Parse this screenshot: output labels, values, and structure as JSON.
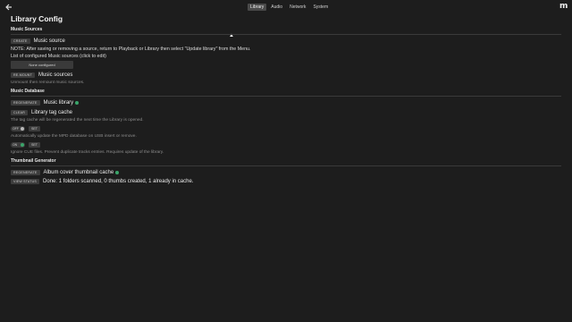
{
  "topbar": {
    "back_icon": "arrow-left-icon",
    "tabs": [
      {
        "label": "Library",
        "active": true
      },
      {
        "label": "Audio",
        "active": false
      },
      {
        "label": "Network",
        "active": false
      },
      {
        "label": "System",
        "active": false
      }
    ],
    "logo_icon": "moode-logo"
  },
  "page": {
    "title": "Library Config"
  },
  "music_sources": {
    "heading": "Music Sources",
    "create_button": "CREATE",
    "create_label": "Music source",
    "note": "NOTE: After saving or removing a source, return to Playback or Library then select \"Update library\" from the Menu.",
    "list_label": "List of configured Music sources (click to edit)",
    "none_configured": "None configured",
    "remount_button": "RE-MOUNT",
    "remount_label": "Music sources",
    "remount_help": "Unmount then remount music sources."
  },
  "music_database": {
    "heading": "Music Database",
    "regenerate_button": "REGENERATE",
    "regenerate_label": "Music library",
    "clear_button": "CLEAR",
    "clear_label": "Library tag cache",
    "clear_help": "The tag cache will be regenerated the next time the Library is opened.",
    "auto_update": {
      "toggle_text": "OFF",
      "set_button": "SET",
      "help": "Automatically update the MPD database on USB insert or remove."
    },
    "ignore_cue": {
      "toggle_text": "ON",
      "set_button": "SET",
      "help": "Ignore CUE files. Prevent duplicate tracks entries. Requires update of the library."
    }
  },
  "thumbnail_generator": {
    "heading": "Thumbnail Generator",
    "regenerate_button": "REGENERATE",
    "regenerate_label": "Album cover thumbnail cache",
    "status_button": "VIEW STATUS",
    "status_text": "Done: 1 folders scanned, 0 thumbs created, 1 already in cache."
  },
  "colors": {
    "background": "#1d1d1d",
    "status_ok": "#3aa56a"
  }
}
